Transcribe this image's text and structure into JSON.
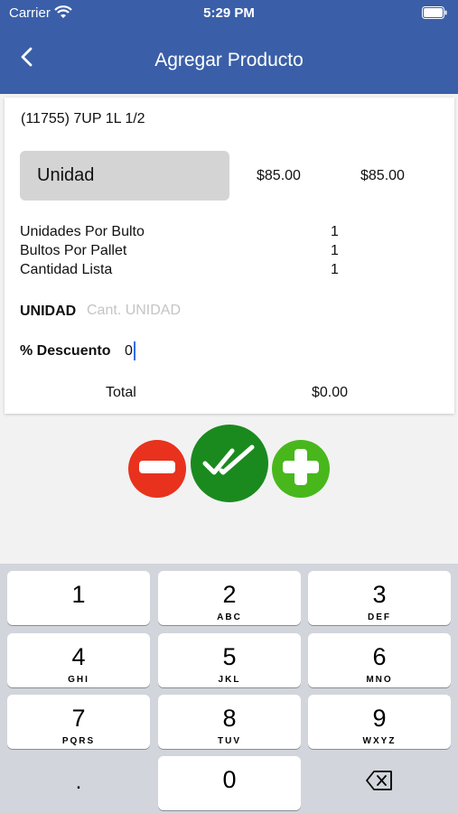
{
  "status_bar": {
    "carrier": "Carrier",
    "time": "5:29 PM"
  },
  "nav": {
    "title": "Agregar Producto"
  },
  "product": {
    "name": "(11755) 7UP 1L 1/2",
    "unit_button": "Unidad",
    "price_1": "$85.00",
    "price_2": "$85.00"
  },
  "info": [
    {
      "label": "Unidades Por Bulto",
      "value": "1"
    },
    {
      "label": "Bultos Por Pallet",
      "value": "1"
    },
    {
      "label": "Cantidad Lista",
      "value": "1"
    }
  ],
  "form": {
    "unidad_label": "UNIDAD",
    "unidad_placeholder": "Cant. UNIDAD",
    "descuento_label": "% Descuento",
    "descuento_value": "0"
  },
  "total": {
    "label": "Total",
    "value": "$0.00"
  },
  "colors": {
    "header": "#3a5fa8",
    "minus": "#e8321e",
    "confirm": "#1a8a1e",
    "plus": "#48b71c"
  },
  "icons": {
    "minus": "minus-circle-icon",
    "confirm": "double-check-icon",
    "plus": "plus-circle-icon",
    "delete": "backspace-icon"
  },
  "keyboard": {
    "keys": [
      {
        "digit": "1",
        "letters": ""
      },
      {
        "digit": "2",
        "letters": "ABC"
      },
      {
        "digit": "3",
        "letters": "DEF"
      },
      {
        "digit": "4",
        "letters": "GHI"
      },
      {
        "digit": "5",
        "letters": "JKL"
      },
      {
        "digit": "6",
        "letters": "MNO"
      },
      {
        "digit": "7",
        "letters": "PQRS"
      },
      {
        "digit": "8",
        "letters": "TUV"
      },
      {
        "digit": "9",
        "letters": "WXYZ"
      },
      {
        "digit": "0",
        "letters": ""
      }
    ],
    "dot": "."
  }
}
